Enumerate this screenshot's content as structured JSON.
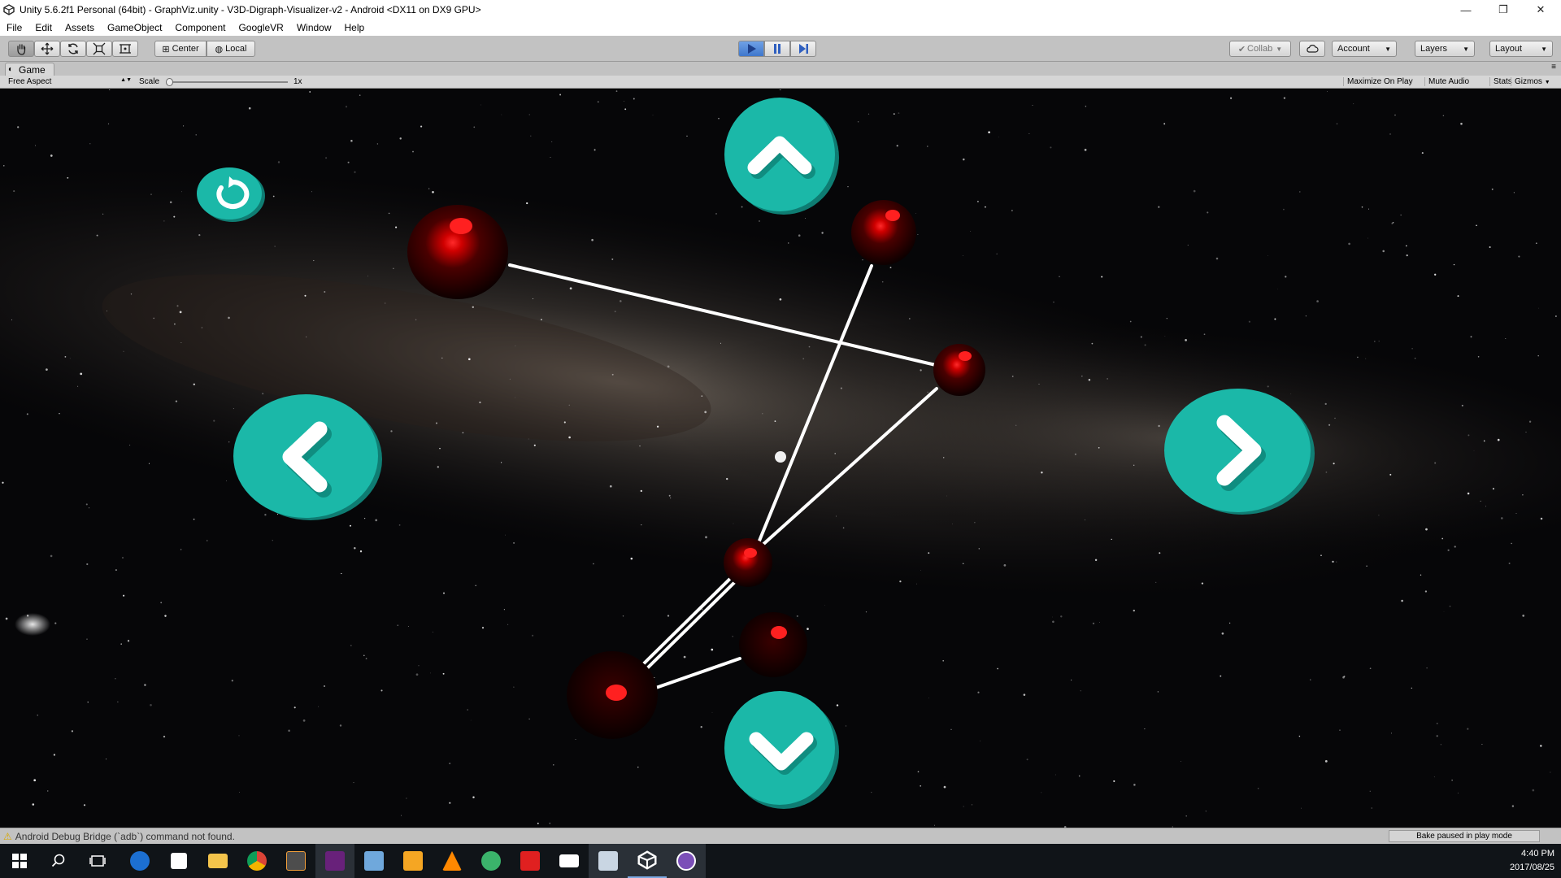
{
  "window": {
    "title": "Unity 5.6.2f1 Personal (64bit) - GraphViz.unity - V3D-Digraph-Visualizer-v2 - Android <DX11 on DX9 GPU>",
    "minimize": "—",
    "restore": "❐",
    "close": "✕"
  },
  "menu": [
    "File",
    "Edit",
    "Assets",
    "GameObject",
    "Component",
    "GoogleVR",
    "Window",
    "Help"
  ],
  "toolbar": {
    "pivot_label": "Center",
    "space_label": "Local",
    "collab_label": "Collab",
    "account_label": "Account",
    "layers_label": "Layers",
    "layout_label": "Layout"
  },
  "game_view": {
    "tab_label": "Game",
    "aspect_label": "Free Aspect",
    "scale_label": "Scale",
    "scale_value": "1x",
    "maximize_label": "Maximize On Play",
    "mute_label": "Mute Audio",
    "stats_label": "Stats",
    "gizmos_label": "Gizmos"
  },
  "status": {
    "message": "Android Debug Bridge (`adb`) command not found.",
    "bake": "Bake paused in play mode"
  },
  "taskbar": {
    "time": "4:40 PM",
    "date": "2017/08/25"
  },
  "colors": {
    "button_teal": "#1bb8a8",
    "button_shadow": "#0f8a7e",
    "node_red": "#ff1a1a",
    "edge": "#ffffff"
  },
  "icons": {
    "up": "chevron-up-icon",
    "down": "chevron-down-icon",
    "left": "chevron-left-icon",
    "right": "chevron-right-icon",
    "reset": "rotate-ccw-icon"
  }
}
